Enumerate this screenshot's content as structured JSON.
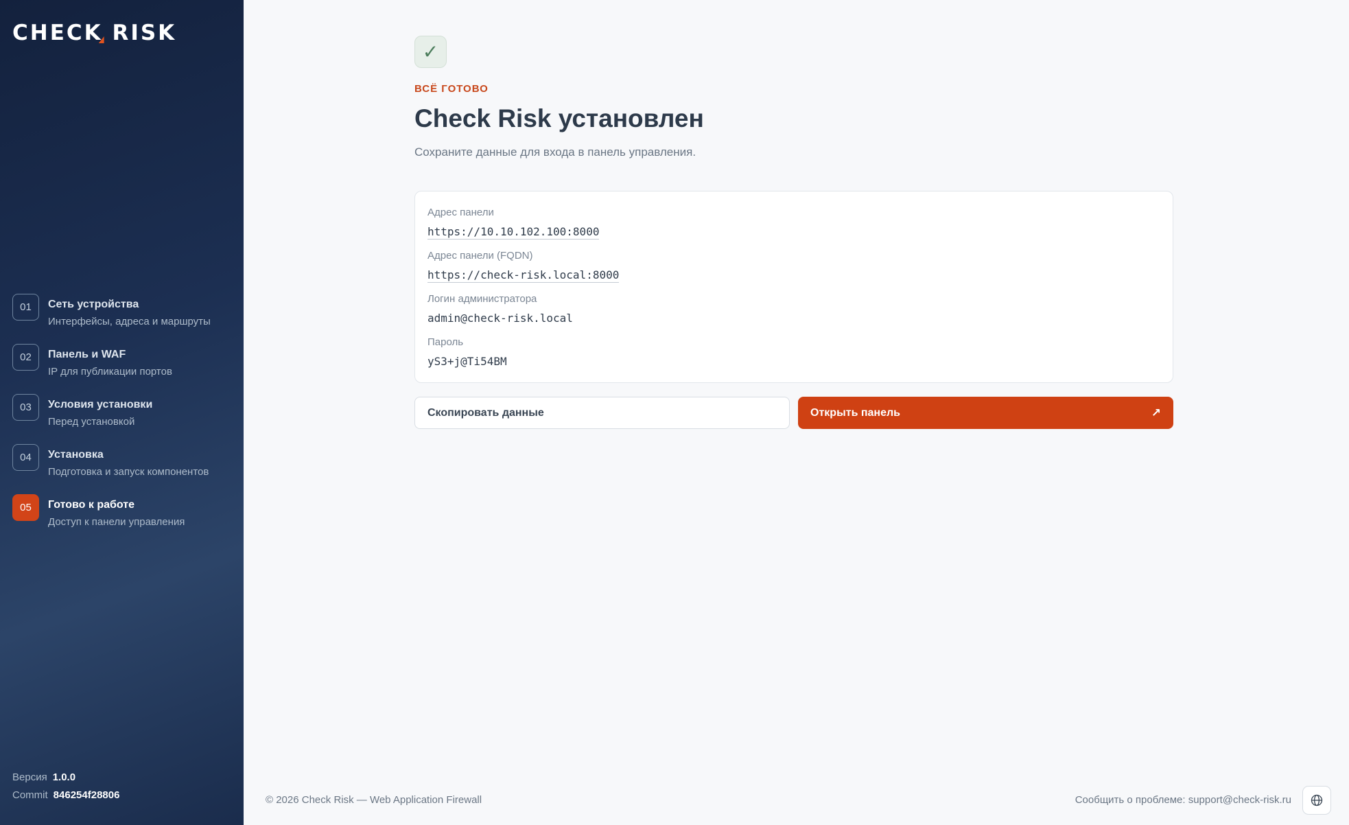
{
  "brand": {
    "logo_main": "CHEC",
    "logo_k": "K",
    "logo_end": " RISK"
  },
  "sidebar": {
    "steps": [
      {
        "num": "01",
        "title": "Сеть устройства",
        "subtitle": "Интерфейсы, адреса и маршруты"
      },
      {
        "num": "02",
        "title": "Панель и WAF",
        "subtitle": "IP для публикации портов"
      },
      {
        "num": "03",
        "title": "Условия установки",
        "subtitle": "Перед установкой"
      },
      {
        "num": "04",
        "title": "Установка",
        "subtitle": "Подготовка и запуск компонентов"
      },
      {
        "num": "05",
        "title": "Готово к работе",
        "subtitle": "Доступ к панели управления"
      }
    ],
    "active_step": 5,
    "version_label": "Версия",
    "version_value": "1.0.0",
    "commit_label": "Commit",
    "commit_value": "846254f28806"
  },
  "main": {
    "check_glyph": "✓",
    "eyebrow": "ВСЁ ГОТОВО",
    "title": "Check Risk установлен",
    "subtitle": "Сохраните данные для входа в панель управления.",
    "fields": [
      {
        "label": "Адрес панели",
        "value": "https://10.10.102.100:8000"
      },
      {
        "label": "Адрес панели (FQDN)",
        "value": "https://check-risk.local:8000"
      },
      {
        "label": "Логин администратора",
        "value": "admin@check-risk.local"
      },
      {
        "label": "Пароль",
        "value": "yS3+j@Ti54BM"
      }
    ],
    "copy_button": "Скопировать данные",
    "open_button": "Открыть панель",
    "open_arrow": "↗"
  },
  "footer": {
    "copyright": "© 2026 Check Risk — Web Application Firewall",
    "report": "Сообщить о проблеме: support@check-risk.ru"
  },
  "colors": {
    "accent": "#cf4113",
    "sidebar_bg": "#1c2f52",
    "success_bg": "#e7efe9"
  },
  "icons": {
    "language": "globe-icon",
    "open": "external-arrow-icon",
    "done": "check-icon"
  }
}
